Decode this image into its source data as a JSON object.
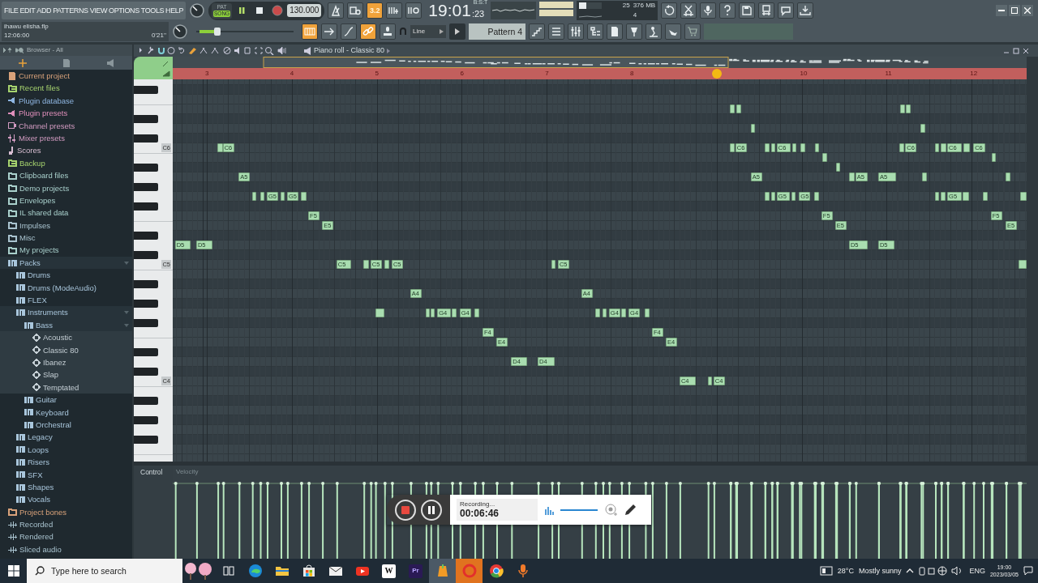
{
  "menu": [
    "FILE",
    "EDIT",
    "ADD",
    "PATTERNS",
    "VIEW",
    "OPTIONS",
    "TOOLS",
    "HELP"
  ],
  "transport": {
    "alt_mode": "PAT",
    "mode": "SONG",
    "song_mode": true,
    "playing": true,
    "tempo": "130.000"
  },
  "tools_top": [
    {
      "on": false
    },
    {
      "on": false
    },
    {
      "on": true,
      "label": "3.2"
    },
    {
      "on": false
    },
    {
      "on": false
    }
  ],
  "clock": {
    "unit": "B:S:T",
    "main": "19:01",
    "sub": ":23"
  },
  "cpu": {
    "voices": "25",
    "memory": "376 MB",
    "polyphony": "4",
    "level": 0.3
  },
  "file": {
    "name": "ihawu elisha.flp",
    "position": "12:06:00",
    "length": "0'21''"
  },
  "master_volume": {
    "level": 0.2
  },
  "tools_bottom": [
    {
      "on": true
    },
    {
      "on": false
    },
    {
      "on": false
    },
    {
      "on": true
    },
    {
      "on": false
    }
  ],
  "snap": "Line",
  "pattern": "Pattern 4",
  "browser": {
    "title": "Browser - All",
    "items": [
      {
        "label": "Current project",
        "kind": "project",
        "color": "#d9a27a",
        "expanded": false
      },
      {
        "label": "Recent files",
        "kind": "recent",
        "color": "#a6d36e",
        "expanded": false
      },
      {
        "label": "Plugin database",
        "kind": "plug",
        "color": "#8fb6e2",
        "expanded": false
      },
      {
        "label": "Plugin presets",
        "kind": "plug",
        "color": "#e08fbb",
        "expanded": false
      },
      {
        "label": "Channel presets",
        "kind": "channel",
        "color": "#d39cc2",
        "expanded": false
      },
      {
        "label": "Mixer presets",
        "kind": "mixer",
        "color": "#d39cc2",
        "expanded": false
      },
      {
        "label": "Scores",
        "kind": "score",
        "color": "#d8bed2",
        "expanded": false
      },
      {
        "label": "Backup",
        "kind": "recent",
        "color": "#a6d36e",
        "expanded": false
      },
      {
        "label": "Clipboard files",
        "kind": "folder",
        "color": "#a9d0cc",
        "expanded": false
      },
      {
        "label": "Demo projects",
        "kind": "folder",
        "color": "#a9d0cc",
        "expanded": false
      },
      {
        "label": "Envelopes",
        "kind": "folder",
        "color": "#a9d0cc",
        "expanded": false
      },
      {
        "label": "IL shared data",
        "kind": "folder",
        "color": "#a9d0cc",
        "expanded": false
      },
      {
        "label": "Impulses",
        "kind": "folder",
        "color": "#a9c3cf",
        "expanded": false
      },
      {
        "label": "Misc",
        "kind": "folder",
        "color": "#a9c3cf",
        "expanded": false
      },
      {
        "label": "My projects",
        "kind": "folder",
        "color": "#a9d0cc",
        "expanded": false
      },
      {
        "label": "Packs",
        "kind": "pack",
        "color": "#a9c6dc",
        "expanded": true,
        "children": [
          {
            "label": "Drums",
            "kind": "pack",
            "color": "#a9c6dc",
            "expanded": false
          },
          {
            "label": "Drums (ModeAudio)",
            "kind": "pack",
            "color": "#a9c6dc",
            "expanded": false
          },
          {
            "label": "FLEX",
            "kind": "pack",
            "color": "#a9c6dc",
            "expanded": false
          },
          {
            "label": "Instruments",
            "kind": "pack",
            "color": "#a9c6dc",
            "expanded": true,
            "children": [
              {
                "label": "Bass",
                "kind": "pack",
                "color": "#a9c6dc",
                "expanded": true,
                "children": [
                  {
                    "label": "Acoustic",
                    "kind": "preset",
                    "color": "#c4ced4",
                    "expanded": false
                  },
                  {
                    "label": "Classic 80",
                    "kind": "preset",
                    "color": "#c4ced4",
                    "expanded": false
                  },
                  {
                    "label": "Ibanez",
                    "kind": "preset",
                    "color": "#c4ced4",
                    "expanded": false
                  },
                  {
                    "label": "Slap",
                    "kind": "preset",
                    "color": "#c4ced4",
                    "expanded": false
                  },
                  {
                    "label": "Temptated",
                    "kind": "preset",
                    "color": "#c4ced4",
                    "expanded": false
                  }
                ]
              },
              {
                "label": "Guitar",
                "kind": "pack",
                "color": "#a9c6dc",
                "expanded": false
              },
              {
                "label": "Keyboard",
                "kind": "pack",
                "color": "#a9c6dc",
                "expanded": false
              },
              {
                "label": "Orchestral",
                "kind": "pack",
                "color": "#a9c6dc",
                "expanded": false
              }
            ]
          },
          {
            "label": "Legacy",
            "kind": "pack",
            "color": "#a9c6dc",
            "expanded": false
          },
          {
            "label": "Loops",
            "kind": "pack",
            "color": "#a9c6dc",
            "expanded": false
          },
          {
            "label": "Risers",
            "kind": "pack",
            "color": "#a9c6dc",
            "expanded": false
          },
          {
            "label": "SFX",
            "kind": "pack",
            "color": "#a9c6dc",
            "expanded": false
          },
          {
            "label": "Shapes",
            "kind": "pack",
            "color": "#a9c6dc",
            "expanded": false
          },
          {
            "label": "Vocals",
            "kind": "pack",
            "color": "#a9c6dc",
            "expanded": false
          }
        ]
      },
      {
        "label": "Project bones",
        "kind": "folder",
        "color": "#d9a27a",
        "expanded": false
      },
      {
        "label": "Recorded",
        "kind": "audio",
        "color": "#a9c3cf",
        "expanded": false
      },
      {
        "label": "Rendered",
        "kind": "audio",
        "color": "#a9c3cf",
        "expanded": false
      },
      {
        "label": "Sliced audio",
        "kind": "audio",
        "color": "#a9c3cf",
        "expanded": false
      }
    ]
  },
  "piano_roll": {
    "title": "Piano roll - Classic 80",
    "bars": [
      "3",
      "4",
      "5",
      "6",
      "7",
      "8",
      "10",
      "11",
      "12"
    ],
    "key_labels": [
      "C6",
      "C5",
      "C4"
    ],
    "notes": [
      {
        "label": "D5",
        "selected": false
      },
      {
        "label": "D5",
        "selected": false
      },
      {
        "selected": false
      },
      {
        "label": "C6",
        "selected": false
      },
      {
        "label": "A5",
        "selected": false
      },
      {
        "selected": false
      },
      {
        "selected": false
      },
      {
        "label": "G5",
        "selected": false
      },
      {
        "selected": false
      },
      {
        "label": "G5",
        "selected": false
      },
      {
        "selected": false
      },
      {
        "label": "F5",
        "selected": false
      },
      {
        "label": "E5",
        "selected": false
      },
      {
        "label": "C5",
        "selected": false
      },
      {
        "selected": false
      },
      {
        "label": "C5",
        "selected": false
      },
      {
        "selected": false
      },
      {
        "label": "C5",
        "selected": false
      },
      {
        "selected": false
      },
      {
        "label": "A4",
        "selected": false
      },
      {
        "selected": false
      },
      {
        "selected": false
      },
      {
        "label": "G4",
        "selected": false
      },
      {
        "selected": false
      },
      {
        "label": "G4",
        "selected": false
      },
      {
        "selected": false
      },
      {
        "label": "F4",
        "selected": false
      },
      {
        "label": "E4",
        "selected": false
      },
      {
        "label": "D4",
        "selected": false
      },
      {
        "label": "D4",
        "selected": false
      },
      {
        "selected": false
      },
      {
        "label": "C5",
        "selected": false
      },
      {
        "label": "A4",
        "selected": false
      },
      {
        "selected": false
      },
      {
        "selected": false
      },
      {
        "label": "G4",
        "selected": false
      },
      {
        "selected": false
      },
      {
        "label": "G4",
        "selected": false
      },
      {
        "selected": false
      },
      {
        "label": "F4",
        "selected": false
      },
      {
        "label": "E4",
        "selected": false
      },
      {
        "label": "C4",
        "selected": false
      },
      {
        "selected": false
      },
      {
        "label": "C4",
        "selected": false
      },
      {
        "selected": false
      },
      {
        "selected": false
      },
      {
        "selected": false
      },
      {
        "label": "C6",
        "selected": false
      },
      {
        "selected": false
      },
      {
        "label": "A5",
        "selected": false
      },
      {
        "selected": false
      },
      {
        "selected": false
      },
      {
        "selected": false
      },
      {
        "selected": false
      },
      {
        "label": "C6",
        "selected": false
      },
      {
        "label": "G5",
        "selected": false
      },
      {
        "selected": false
      },
      {
        "selected": false
      },
      {
        "selected": false
      },
      {
        "label": "G5",
        "selected": false
      },
      {
        "selected": false
      },
      {
        "selected": false
      },
      {
        "selected": false
      },
      {
        "label": "F5",
        "selected": false
      },
      {
        "selected": false
      },
      {
        "label": "E5",
        "selected": false
      },
      {
        "selected": false
      },
      {
        "label": "D5",
        "selected": false
      },
      {
        "label": "A5",
        "selected": false
      },
      {
        "label": "A5",
        "selected": false
      },
      {
        "label": "D5",
        "selected": false
      },
      {
        "selected": false
      },
      {
        "selected": false
      },
      {
        "selected": false
      },
      {
        "label": "C6",
        "selected": false
      },
      {
        "selected": false
      },
      {
        "selected": false
      },
      {
        "selected": false
      },
      {
        "selected": false
      },
      {
        "selected": false
      },
      {
        "selected": false
      },
      {
        "label": "C6",
        "selected": false
      },
      {
        "label": "G5",
        "selected": false
      },
      {
        "selected": false
      },
      {
        "selected": false
      },
      {
        "label": "C6",
        "selected": false
      },
      {
        "selected": false
      },
      {
        "selected": false
      },
      {
        "label": "F5",
        "selected": false
      },
      {
        "selected": false
      },
      {
        "label": "E5",
        "selected": false
      },
      {
        "selected": false
      },
      {
        "selected": false
      }
    ],
    "control": {
      "label": "Control",
      "parameter": "Velocity"
    }
  },
  "recorder": {
    "status": "Recording...",
    "elapsed": "00:06:46",
    "level": 1
  },
  "taskbar": {
    "search_placeholder": "Type here to search",
    "apps": [
      {
        "kind": "edge",
        "active": false,
        "flashing": false
      },
      {
        "kind": "explorer",
        "active": false,
        "flashing": false
      },
      {
        "kind": "store",
        "active": false,
        "flashing": false
      },
      {
        "kind": "mail",
        "active": false,
        "flashing": false
      },
      {
        "kind": "youtube",
        "active": false,
        "flashing": false
      },
      {
        "kind": "lettered",
        "label": "W",
        "active": false,
        "flashing": false
      },
      {
        "kind": "premiere",
        "label": "Pr",
        "active": false,
        "flashing": false
      },
      {
        "kind": "fl",
        "active": true,
        "flashing": false
      },
      {
        "kind": "opera",
        "active": false,
        "flashing": true
      },
      {
        "kind": "chrome",
        "active": false,
        "flashing": false
      },
      {
        "kind": "mic",
        "active": false,
        "flashing": false
      }
    ],
    "weather": {
      "temperature": "28°C",
      "condition": "Mostly sunny"
    },
    "language": "ENG",
    "time": "19:00",
    "date": "2023/03/05"
  }
}
